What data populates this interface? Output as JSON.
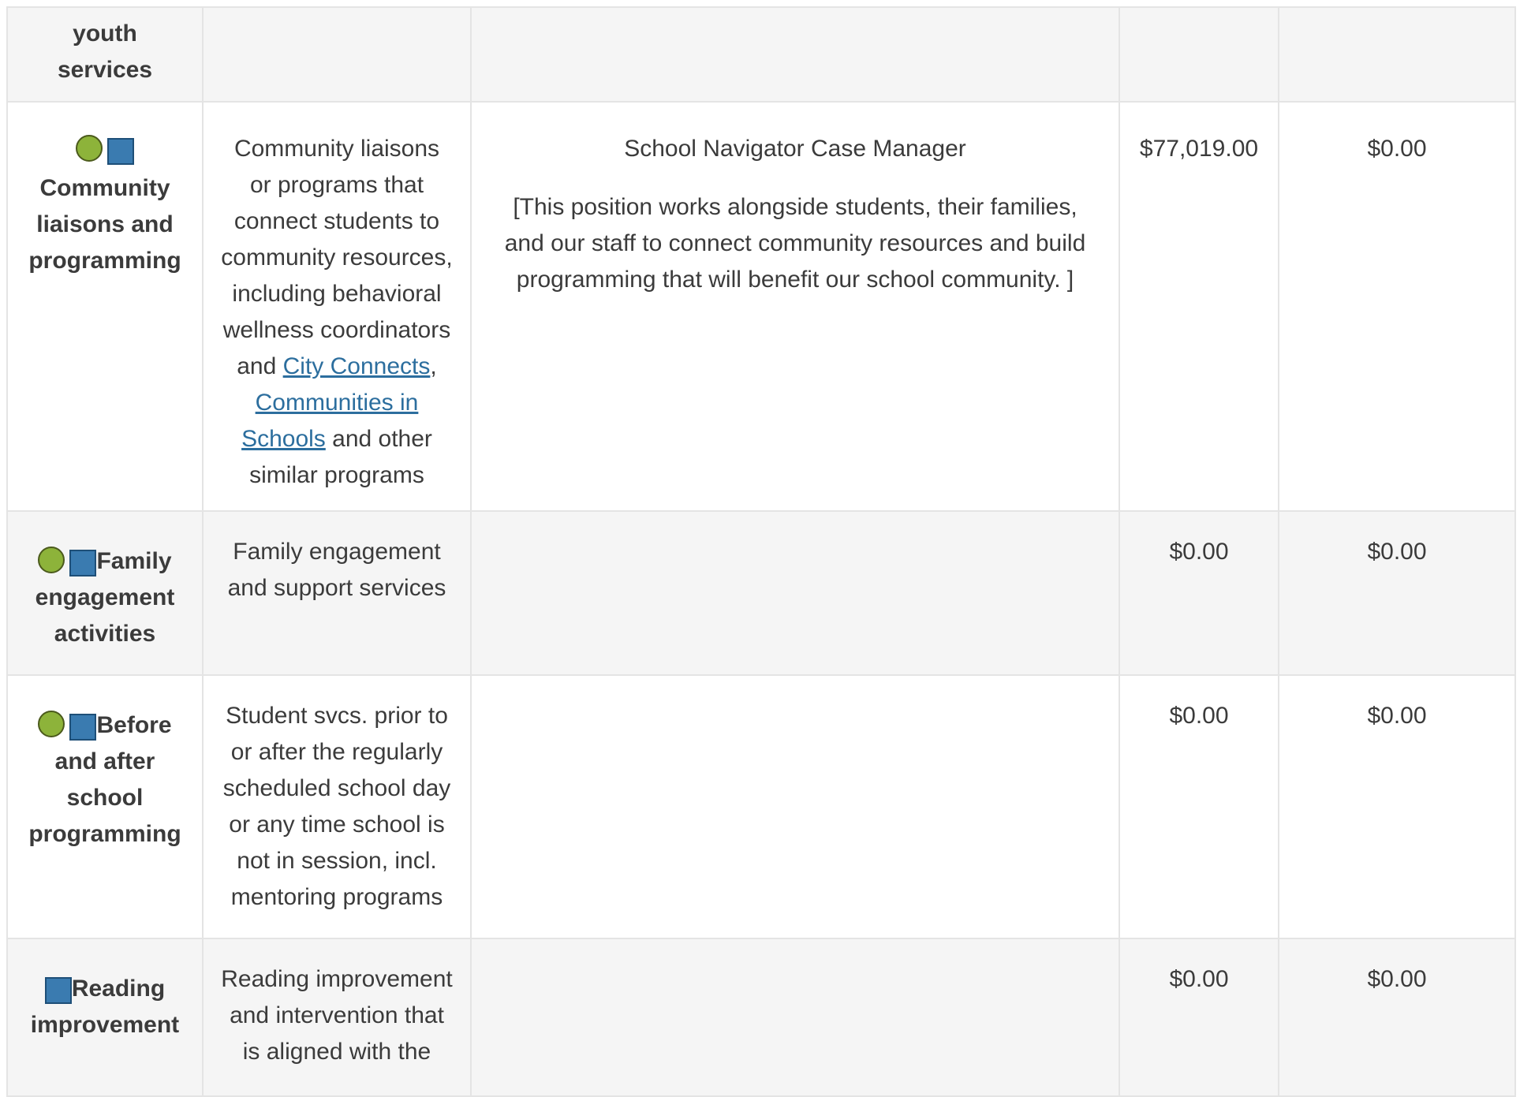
{
  "rows": [
    {
      "category": "youth services",
      "category_lines": [
        "youth",
        "services"
      ],
      "description": "",
      "detail_title": "",
      "detail_body": "",
      "amount1": "",
      "amount2": ""
    },
    {
      "category": "Community liaisons and programming",
      "category_lines": [
        "Community",
        "liaisons and",
        "programming"
      ],
      "icons": [
        "green-circle-icon",
        "blue-square-icon"
      ],
      "description_lines": [
        "Community liaisons",
        "or programs that",
        "connect students to",
        "community resources,",
        "including behavioral",
        "wellness coordinators"
      ],
      "description_and": "and ",
      "link1": "City Connects",
      "comma": ",",
      "link2_line1": "Communities in",
      "link2_line2": "Schools",
      "description_tail": " and other",
      "description_last": "similar programs",
      "detail_title": "School Navigator Case Manager",
      "detail_body_lines": [
        "[This position works alongside students, their families,",
        "and our staff to connect community resources and build",
        "programming that will benefit our school community. ]"
      ],
      "amount1": "$77,019.00",
      "amount2": "$0.00"
    },
    {
      "category": "Family engagement activities",
      "category_lines": [
        "Family",
        "engagement",
        "activities"
      ],
      "icons": [
        "green-circle-icon",
        "blue-square-icon"
      ],
      "description_lines": [
        "Family engagement",
        "and support services"
      ],
      "amount1": "$0.00",
      "amount2": "$0.00"
    },
    {
      "category": "Before and after school programming",
      "category_lines": [
        "Before",
        "and after",
        "school",
        "programming"
      ],
      "icons": [
        "green-circle-icon",
        "blue-square-icon"
      ],
      "description_lines": [
        "Student svcs. prior to",
        "or after the regularly",
        "scheduled school day",
        "or any time school is",
        "not in session, incl.",
        "mentoring programs"
      ],
      "amount1": "$0.00",
      "amount2": "$0.00"
    },
    {
      "category": "Reading improvement",
      "category_lines": [
        "Reading",
        "improvement"
      ],
      "icons": [
        "blue-square-icon"
      ],
      "description_lines": [
        "Reading improvement",
        "and intervention that",
        "is aligned with the"
      ],
      "amount1": "$0.00",
      "amount2": "$0.00"
    }
  ],
  "colors": {
    "circle_icon": "#8db33a",
    "square_icon": "#3a7bb0",
    "link": "#2c6e9e",
    "row_shade": "#f5f5f5",
    "border": "#e4e4e4"
  }
}
